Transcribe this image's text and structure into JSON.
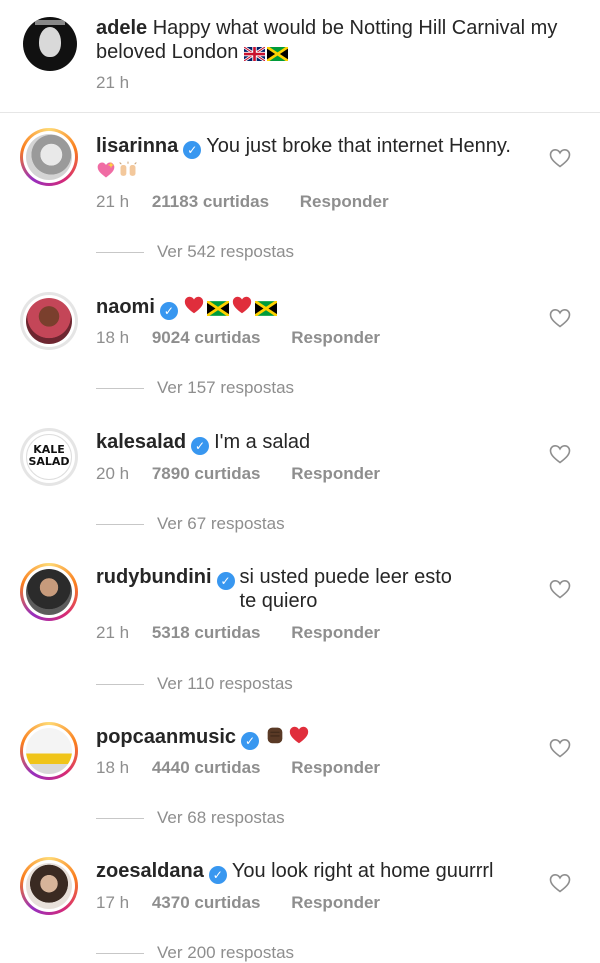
{
  "caption": {
    "username": "adele",
    "text": "Happy what would be Notting Hill Carnival my beloved London",
    "emojis": [
      "uk-flag",
      "jamaica-flag"
    ],
    "time": "21 h"
  },
  "comments": [
    {
      "username": "lisarinna",
      "text": "You just broke that internet Henny.",
      "emojis": [
        "sparkling-heart",
        "raised-hands"
      ],
      "time": "21 h",
      "likes": "21183 curtidas",
      "reply": "Responder",
      "view_replies": "Ver 542 respostas"
    },
    {
      "username": "naomi",
      "text": "",
      "emojis": [
        "red-heart",
        "jamaica-flag",
        "red-heart",
        "jamaica-flag"
      ],
      "time": "18 h",
      "likes": "9024 curtidas",
      "reply": "Responder",
      "view_replies": "Ver 157 respostas"
    },
    {
      "username": "kalesalad",
      "text": "I'm a salad",
      "emojis": [],
      "avatar_text": "KALE SALAD",
      "time": "20 h",
      "likes": "7890 curtidas",
      "reply": "Responder",
      "view_replies": "Ver 67 respostas"
    },
    {
      "username": "rudybundini",
      "text": "si usted puede leer esto te quiero",
      "emojis": [],
      "time": "21 h",
      "likes": "5318 curtidas",
      "reply": "Responder",
      "view_replies": "Ver 110 respostas"
    },
    {
      "username": "popcaanmusic",
      "text": "",
      "emojis": [
        "raised-fist",
        "red-heart"
      ],
      "time": "18 h",
      "likes": "4440 curtidas",
      "reply": "Responder",
      "view_replies": "Ver 68 respostas"
    },
    {
      "username": "zoesaldana",
      "text": "You look right at home guurrrl",
      "emojis": [],
      "time": "17 h",
      "likes": "4370 curtidas",
      "reply": "Responder",
      "view_replies": "Ver 200 respostas"
    }
  ],
  "colors": {
    "text": "#262626",
    "muted": "#8e8e8e",
    "verified": "#3897f0",
    "heart": "#e02e3c"
  }
}
